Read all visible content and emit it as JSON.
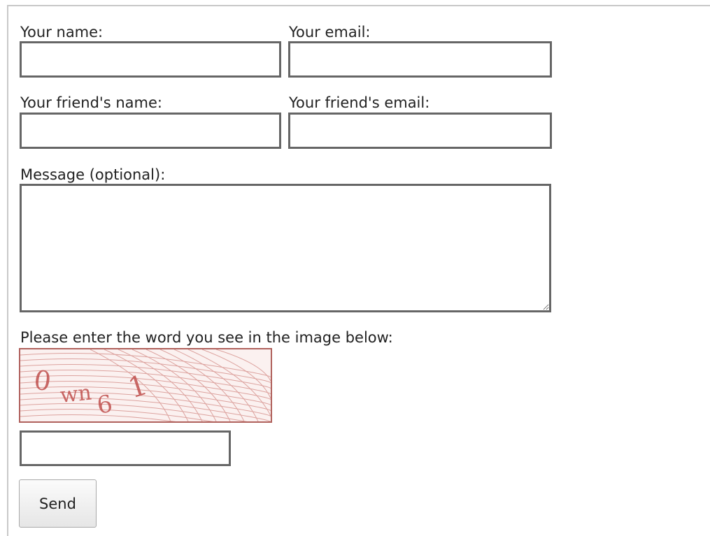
{
  "form": {
    "your_name_label": "Your name:",
    "your_email_label": "Your email:",
    "friend_name_label": "Your friend's name:",
    "friend_email_label": "Your friend's email:",
    "message_label": "Message (optional):",
    "captcha_prompt": "Please enter the word you see in the image below:",
    "captcha_text": "0wn6 1",
    "your_name_value": "",
    "your_email_value": "",
    "friend_name_value": "",
    "friend_email_value": "",
    "message_value": "",
    "captcha_value": "",
    "send_label": "Send"
  },
  "colors": {
    "field_border": "#666666",
    "captcha_ink": "#c0504d",
    "captcha_lines": "#d99a96"
  }
}
